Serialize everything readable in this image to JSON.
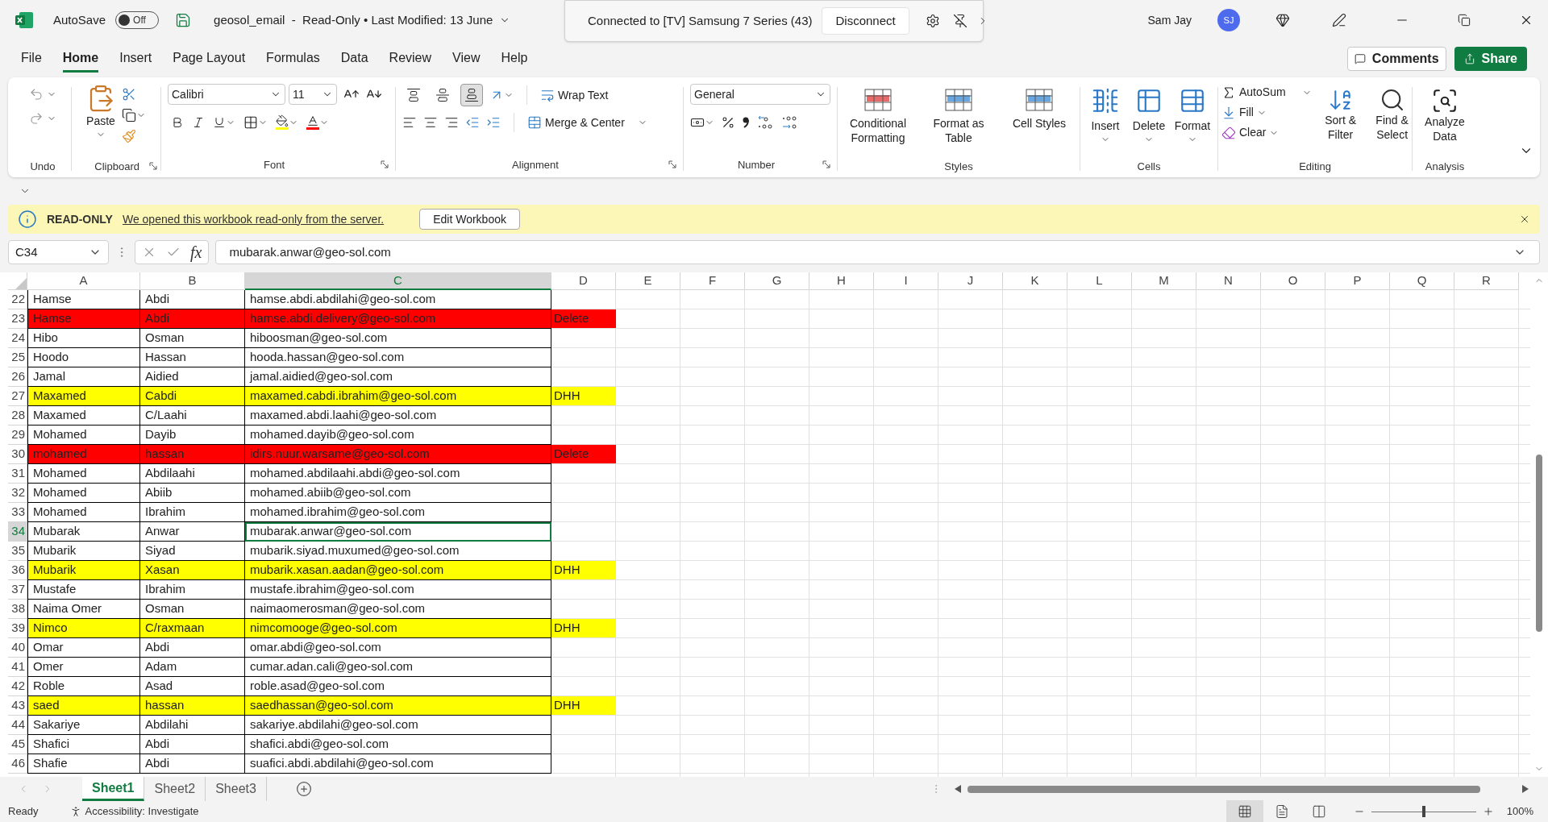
{
  "title_bar": {
    "autosave_label": "AutoSave",
    "autosave_on": false,
    "toggle_text": "Off",
    "title": "geosol_email  -  Read-Only • Last Modified: 13 June",
    "cast_text": "Connected to [TV] Samsung 7 Series (43)",
    "cast_button": "Disconnect",
    "user": "Sam Jay",
    "initials": "SJ"
  },
  "menu_tabs": [
    {
      "label": "File",
      "selected": false
    },
    {
      "label": "Home",
      "selected": true
    },
    {
      "label": "Insert",
      "selected": false
    },
    {
      "label": "Page Layout",
      "selected": false
    },
    {
      "label": "Formulas",
      "selected": false
    },
    {
      "label": "Data",
      "selected": false
    },
    {
      "label": "Review",
      "selected": false
    },
    {
      "label": "View",
      "selected": false
    },
    {
      "label": "Help",
      "selected": false
    }
  ],
  "comments_button": "Comments",
  "share_button": "Share",
  "ribbon": {
    "undo": {
      "label": "Undo"
    },
    "clipboard": {
      "label": "Clipboard",
      "paste": "Paste"
    },
    "font": {
      "label": "Font",
      "family": "Calibri",
      "size": "11"
    },
    "alignment": {
      "label": "Alignment",
      "wrap": "Wrap Text",
      "merge": "Merge & Center",
      "vertical": [
        {
          "selected": false
        },
        {
          "selected": false
        },
        {
          "selected": true
        }
      ]
    },
    "number": {
      "label": "Number",
      "format": "General"
    },
    "styles": {
      "label": "Styles",
      "buttons": [
        "Conditional Formatting",
        "Format as Table",
        "Cell Styles"
      ]
    },
    "cells": {
      "label": "Cells",
      "buttons": [
        "Insert",
        "Delete",
        "Format"
      ]
    },
    "editing": {
      "label": "Editing",
      "autosum": "AutoSum",
      "fill": "Fill",
      "clear": "Clear",
      "buttons": [
        "Sort & Filter",
        "Find & Select"
      ]
    },
    "analysis": {
      "label": "Analysis",
      "buttons": [
        "Analyze Data"
      ]
    }
  },
  "banner": {
    "title": "READ-ONLY",
    "message": "We opened this workbook read-only from the server.",
    "button": "Edit Workbook"
  },
  "formula_bar": {
    "name_box": "C34",
    "fx": "fx",
    "value": "mubarak.anwar@geo-sol.com"
  },
  "columns": [
    {
      "label": "A",
      "selected": false
    },
    {
      "label": "B",
      "selected": false
    },
    {
      "label": "C",
      "selected": true
    },
    {
      "label": "D",
      "selected": false
    },
    {
      "label": "E",
      "selected": false
    },
    {
      "label": "F",
      "selected": false
    },
    {
      "label": "G",
      "selected": false
    },
    {
      "label": "H",
      "selected": false
    },
    {
      "label": "I",
      "selected": false
    },
    {
      "label": "J",
      "selected": false
    },
    {
      "label": "K",
      "selected": false
    },
    {
      "label": "L",
      "selected": false
    },
    {
      "label": "M",
      "selected": false
    },
    {
      "label": "N",
      "selected": false
    },
    {
      "label": "O",
      "selected": false
    },
    {
      "label": "P",
      "selected": false
    },
    {
      "label": "Q",
      "selected": false
    },
    {
      "label": "R",
      "selected": false
    }
  ],
  "rows": [
    {
      "number": "22",
      "a": "Hamse",
      "b": "Abdi",
      "c": "hamse.abdi.abdilahi@geo-sol.com",
      "selected": false
    },
    {
      "number": "23",
      "a": "Hamse",
      "b": "Abdi",
      "c": "hamse.abdi.delivery@geo-sol.com",
      "d": "Delete",
      "color": "#ff0000",
      "selected": false
    },
    {
      "number": "24",
      "a": "Hibo",
      "b": "Osman",
      "c": "hiboosman@geo-sol.com",
      "selected": false
    },
    {
      "number": "25",
      "a": "Hoodo",
      "b": "Hassan",
      "c": "hooda.hassan@geo-sol.com",
      "selected": false
    },
    {
      "number": "26",
      "a": "Jamal",
      "b": "Aidied",
      "c": "jamal.aidied@geo-sol.com",
      "selected": false
    },
    {
      "number": "27",
      "a": "Maxamed",
      "b": "Cabdi",
      "c": "maxamed.cabdi.ibrahim@geo-sol.com",
      "d": "DHH",
      "color": "#ffff00",
      "selected": false
    },
    {
      "number": "28",
      "a": "Maxamed",
      "b": "C/Laahi",
      "c": "maxamed.abdi.laahi@geo-sol.com",
      "selected": false
    },
    {
      "number": "29",
      "a": "Mohamed",
      "b": "Dayib",
      "c": "mohamed.dayib@geo-sol.com",
      "selected": false
    },
    {
      "number": "30",
      "a": "mohamed",
      "b": "hassan",
      "c": "idirs.nuur.warsame@geo-sol.com",
      "d": "Delete",
      "color": "#ff0000",
      "selected": false
    },
    {
      "number": "31",
      "a": "Mohamed",
      "b": "Abdilaahi",
      "c": "mohamed.abdilaahi.abdi@geo-sol.com",
      "selected": false
    },
    {
      "number": "32",
      "a": "Mohamed",
      "b": "Abiib",
      "c": "mohamed.abiib@geo-sol.com",
      "selected": false
    },
    {
      "number": "33",
      "a": "Mohamed",
      "b": "Ibrahim",
      "c": "mohamed.ibrahim@geo-sol.com",
      "selected": false
    },
    {
      "number": "34",
      "a": "Mubarak",
      "b": "Anwar",
      "c": "mubarak.anwar@geo-sol.com",
      "selected": true
    },
    {
      "number": "35",
      "a": "Mubarik",
      "b": "Siyad",
      "c": "mubarik.siyad.muxumed@geo-sol.com",
      "selected": false
    },
    {
      "number": "36",
      "a": "Mubarik",
      "b": "Xasan",
      "c": "mubarik.xasan.aadan@geo-sol.com",
      "d": "DHH",
      "color": "#ffff00",
      "selected": false
    },
    {
      "number": "37",
      "a": "Mustafe",
      "b": "Ibrahim",
      "c": "mustafe.ibrahim@geo-sol.com",
      "selected": false
    },
    {
      "number": "38",
      "a": "Naima Omer",
      "b": "Osman",
      "c": "naimaomerosman@geo-sol.com",
      "selected": false
    },
    {
      "number": "39",
      "a": "Nimco",
      "b": "C/raxmaan",
      "c": "nimcomooge@geo-sol.com",
      "d": "DHH",
      "color": "#ffff00",
      "selected": false
    },
    {
      "number": "40",
      "a": "Omar",
      "b": "Abdi",
      "c": "omar.abdi@geo-sol.com",
      "selected": false
    },
    {
      "number": "41",
      "a": "Omer",
      "b": "Adam",
      "c": "cumar.adan.cali@geo-sol.com",
      "selected": false
    },
    {
      "number": "42",
      "a": "Roble",
      "b": "Asad",
      "c": "roble.asad@geo-sol.com",
      "selected": false
    },
    {
      "number": "43",
      "a": "saed",
      "b": "hassan",
      "c": "saedhassan@geo-sol.com",
      "d": "DHH",
      "color": "#ffff00",
      "selected": false
    },
    {
      "number": "44",
      "a": "Sakariye",
      "b": "Abdilahi",
      "c": "sakariye.abdilahi@geo-sol.com",
      "selected": false
    },
    {
      "number": "45",
      "a": "Shafici",
      "b": "Abdi",
      "c": "shafici.abdi@geo-sol.com",
      "selected": false
    },
    {
      "number": "46",
      "a": "Shafie",
      "b": "Abdi",
      "c": "suafici.abdi.abdilahi@geo-sol.com",
      "selected": false
    }
  ],
  "sheets": [
    {
      "label": "Sheet1",
      "selected": true
    },
    {
      "label": "Sheet2",
      "selected": false
    },
    {
      "label": "Sheet3",
      "selected": false
    }
  ],
  "status_bar": {
    "ready": "Ready",
    "accessibility": "Accessibility: Investigate",
    "views": [
      {
        "selected": true
      },
      {
        "selected": false
      },
      {
        "selected": false
      }
    ],
    "zoom": {
      "level": 0.5
    },
    "zoom_text": "100%"
  }
}
